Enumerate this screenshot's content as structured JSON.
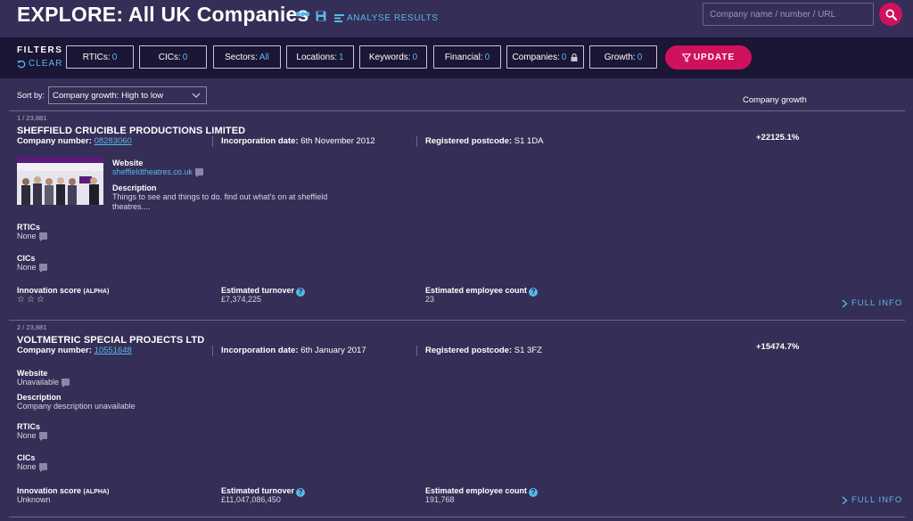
{
  "header": {
    "title": "EXPLORE: All UK Companies",
    "more_glyph": "•••",
    "save_icon": "floppy-disk-icon",
    "analyse_label": "ANALYSE RESULTS",
    "search_placeholder": "Company name / number / URL",
    "accent_color": "#57b8e8",
    "brand_color": "#d0115d"
  },
  "filters": {
    "title": "FILTERS",
    "clear_label": "CLEAR",
    "chips": [
      {
        "label": "RTICs:",
        "value": "0"
      },
      {
        "label": "CICs:",
        "value": "0"
      },
      {
        "label": "Sectors:",
        "value": "All"
      },
      {
        "label": "Locations:",
        "value": "1"
      },
      {
        "label": "Keywords:",
        "value": "0"
      },
      {
        "label": "Financial:",
        "value": "0"
      },
      {
        "label": "Companies:",
        "value": "0"
      },
      {
        "label": "Growth:",
        "value": "0"
      }
    ],
    "update_label": "UPDATE"
  },
  "sort": {
    "label": "Sort by:",
    "selected": "Company growth: High to low"
  },
  "columns": {
    "growth_header": "Company growth"
  },
  "labels": {
    "company_number": "Company number:",
    "incorporation": "Incorporation date:",
    "postcode": "Registered postcode:",
    "website": "Website",
    "description": "Description",
    "rtics": "RTICs",
    "cics": "CICs",
    "innovation": "Innovation score",
    "innovation_tag": "(ALPHA)",
    "turnover": "Estimated turnover",
    "employees": "Estimated employee count",
    "full_info": "FULL INFO",
    "help_glyph": "?"
  },
  "results": [
    {
      "count": "1 / 23,881",
      "name": "SHEFFIELD CRUCIBLE PRODUCTIONS LIMITED",
      "company_number": "08283060",
      "incorporation_date": "6th November 2012",
      "postcode": "S1 1DA",
      "growth": "+22125.1%",
      "website": "sheffieldtheatres.co.uk",
      "description": "Things to see and things to do. find out what's on at sheffield theatres....",
      "rtics": "None",
      "cics": "None",
      "innovation_stars": "☆☆☆",
      "turnover": "£7,374,225",
      "employees": "23"
    },
    {
      "count": "2 / 23,881",
      "name": "VOLTMETRIC SPECIAL PROJECTS LTD",
      "company_number": "10551648",
      "incorporation_date": "6th January 2017",
      "postcode": "S1 3FZ",
      "growth": "+15474.7%",
      "website": "Unavailable",
      "description": "Company description unavailable",
      "rtics": "None",
      "cics": "None",
      "innovation": "Unknown",
      "turnover": "£11,047,086,450",
      "employees": "191,768"
    }
  ]
}
